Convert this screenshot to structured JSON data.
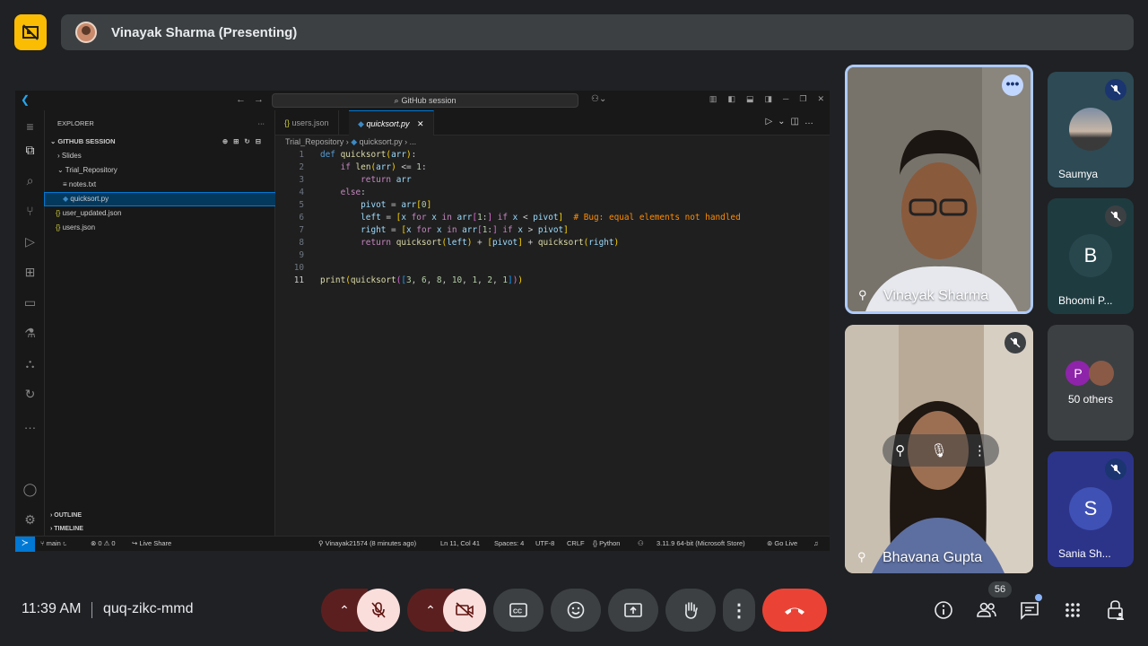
{
  "presenting_bar": {
    "label": "Vinayak Sharma (Presenting)"
  },
  "vscode": {
    "search": "GitHub session",
    "sidebar": {
      "header": "EXPLORER",
      "section": "GITHUB SESSION",
      "tree": [
        {
          "label": "Slides",
          "prefix": "›",
          "indent": 1
        },
        {
          "label": "Trial_Repository",
          "prefix": "⌄",
          "indent": 1
        },
        {
          "label": "notes.txt",
          "prefix": "≡",
          "indent": 2
        },
        {
          "label": "quicksort.py",
          "prefix": "◆",
          "indent": 2,
          "selected": true
        },
        {
          "label": "user_updated.json",
          "prefix": "{}",
          "indent": 1
        },
        {
          "label": "users.json",
          "prefix": "{}",
          "indent": 1
        }
      ],
      "outline": "OUTLINE",
      "timeline": "TIMELINE"
    },
    "tabs": [
      {
        "label": "users.json",
        "prefix": "{}"
      },
      {
        "label": "quicksort.py",
        "prefix": "◆",
        "active": true
      }
    ],
    "breadcrumb": {
      "folder": "Trial_Repository",
      "file": "quicksort.py",
      "more": "..."
    },
    "code_lines": [
      {
        "n": "1",
        "text": "def quicksort(arr):"
      },
      {
        "n": "2",
        "text": "    if len(arr) <= 1:"
      },
      {
        "n": "3",
        "text": "        return arr"
      },
      {
        "n": "4",
        "text": "    else:"
      },
      {
        "n": "5",
        "text": "        pivot = arr[0]"
      },
      {
        "n": "6",
        "text": "        left = [x for x in arr[1:] if x < pivot]  # Bug: equal elements not handled"
      },
      {
        "n": "7",
        "text": "        right = [x for x in arr[1:] if x > pivot]"
      },
      {
        "n": "8",
        "text": "        return quicksort(left) + [pivot] + quicksort(right)"
      },
      {
        "n": "9",
        "text": ""
      },
      {
        "n": "10",
        "text": ""
      },
      {
        "n": "11",
        "text": "print(quicksort([3, 6, 8, 10, 1, 2, 1]))"
      }
    ],
    "status": {
      "branch": "main",
      "problems": "⊗ 0 ⚠ 0",
      "live_share": "Live Share",
      "author": "Vinayak21574 (8 minutes ago)",
      "cursor": "Ln 11, Col 41",
      "spaces": "Spaces: 4",
      "encoding": "UTF-8",
      "eol": "CRLF",
      "language": "{} Python",
      "interpreter": "3.11.9 64-bit (Microsoft Store)",
      "go_live": "Go Live"
    }
  },
  "participants": {
    "main_tile": {
      "name": "Vinayak Sharma"
    },
    "second_tile": {
      "name": "Bhavana Gupta"
    },
    "side": [
      {
        "name": "Saumya"
      },
      {
        "name": "Bhoomi P...",
        "initial": "B",
        "color": "#174ea6"
      },
      {
        "name": "50 others",
        "initial": "P",
        "color": "#8e24aa"
      },
      {
        "name": "Sania Sh...",
        "initial": "S",
        "color": "#3949ab"
      }
    ]
  },
  "bottom": {
    "time": "11:39 AM",
    "meeting_code": "quq-zikc-mmd",
    "people_count": "56",
    "end_call_color": "#ea4335"
  }
}
